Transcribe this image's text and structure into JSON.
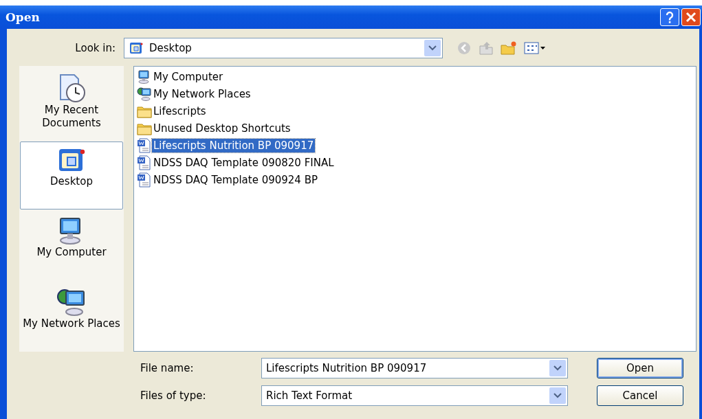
{
  "window": {
    "title": "Open"
  },
  "look_in": {
    "label": "Look in:",
    "value": "Desktop"
  },
  "places": [
    {
      "label": "My Recent Documents",
      "kind": "recent",
      "selected": false
    },
    {
      "label": "Desktop",
      "kind": "desktop",
      "selected": true
    },
    {
      "label": "My Computer",
      "kind": "computer",
      "selected": false
    },
    {
      "label": "My Network Places",
      "kind": "network",
      "selected": false
    }
  ],
  "files": [
    {
      "name": "My Computer",
      "kind": "computer",
      "selected": false
    },
    {
      "name": "My Network Places",
      "kind": "network",
      "selected": false
    },
    {
      "name": "Lifescripts",
      "kind": "folder",
      "selected": false
    },
    {
      "name": "Unused Desktop Shortcuts",
      "kind": "folder",
      "selected": false
    },
    {
      "name": "Lifescripts Nutrition BP 090917",
      "kind": "document",
      "selected": true
    },
    {
      "name": "NDSS DAQ Template 090820 FINAL",
      "kind": "document",
      "selected": false
    },
    {
      "name": "NDSS DAQ Template 090924 BP",
      "kind": "document",
      "selected": false
    }
  ],
  "file_name": {
    "label": "File name:",
    "value": "Lifescripts Nutrition BP 090917"
  },
  "file_type": {
    "label": "Files of type:",
    "value": "Rich Text Format"
  },
  "buttons": [
    {
      "label": "Open",
      "kind": "default"
    },
    {
      "label": "Cancel",
      "kind": "normal"
    }
  ]
}
